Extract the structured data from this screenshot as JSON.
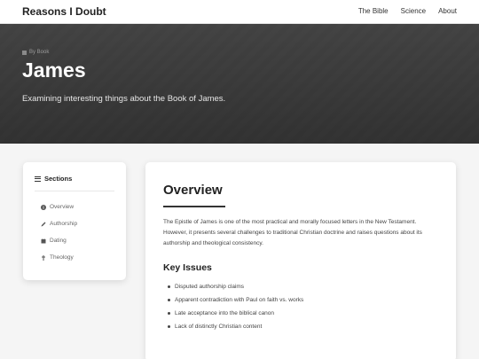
{
  "navbar": {
    "brand": "Reasons I Doubt",
    "links": [
      "The Bible",
      "Science",
      "About"
    ]
  },
  "hero": {
    "breadcrumb": "By Book",
    "title": "James",
    "subtitle": "Examining interesting things about the Book of James."
  },
  "sidebar": {
    "title": "Sections",
    "items": [
      {
        "label": "Overview",
        "icon": "info-icon"
      },
      {
        "label": "Authorship",
        "icon": "pen-icon"
      },
      {
        "label": "Dating",
        "icon": "calendar-icon"
      },
      {
        "label": "Theology",
        "icon": "cross-icon"
      }
    ]
  },
  "content": {
    "title": "Overview",
    "paragraph": "The Epistle of James is one of the most practical and morally focused letters in the New Testament. However, it presents several challenges to traditional Christian doctrine and raises questions about its authorship and theological consistency.",
    "subheading": "Key Issues",
    "issues": [
      "Disputed authorship claims",
      "Apparent contradiction with Paul on faith vs. works",
      "Late acceptance into the biblical canon",
      "Lack of distinctly Christian content"
    ]
  }
}
